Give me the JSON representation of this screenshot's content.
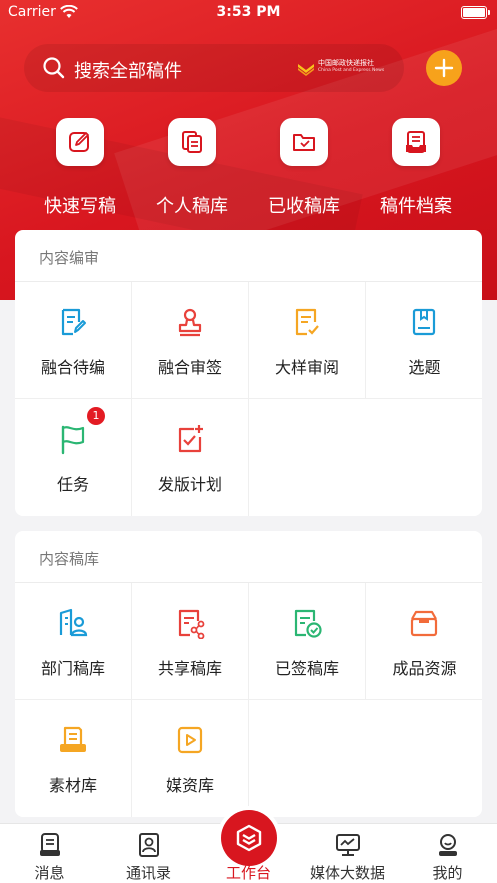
{
  "status_bar": {
    "carrier": "Carrier",
    "time": "3:53 PM"
  },
  "search": {
    "placeholder": "搜索全部稿件"
  },
  "brand": {
    "name_cn": "中国邮政快递报社",
    "name_en": "China Post and Express News"
  },
  "colors": {
    "primary": "#d8161f",
    "accent": "#f7a21b",
    "blue": "#1a9bd7",
    "green": "#2bb673",
    "orange": "#f5a623"
  },
  "quick_actions": [
    {
      "label": "快速写稿",
      "icon": "edit-icon"
    },
    {
      "label": "个人稿库",
      "icon": "documents-icon"
    },
    {
      "label": "已收稿库",
      "icon": "folder-icon"
    },
    {
      "label": "稿件档案",
      "icon": "archive-icon"
    }
  ],
  "content_review": {
    "title": "内容编审",
    "items": [
      {
        "label": "融合待编",
        "icon": "document-edit-icon"
      },
      {
        "label": "融合审签",
        "icon": "stamp-icon"
      },
      {
        "label": "大样审阅",
        "icon": "document-check-icon"
      },
      {
        "label": "选题",
        "icon": "bookmark-doc-icon"
      },
      {
        "label": "任务",
        "icon": "flag-icon",
        "badge": "1"
      },
      {
        "label": "发版计划",
        "icon": "plan-icon"
      }
    ]
  },
  "content_library": {
    "title": "内容稿库",
    "items": [
      {
        "label": "部门稿库",
        "icon": "department-icon"
      },
      {
        "label": "共享稿库",
        "icon": "share-doc-icon"
      },
      {
        "label": "已签稿库",
        "icon": "signed-doc-icon"
      },
      {
        "label": "成品资源",
        "icon": "inbox-box-icon"
      },
      {
        "label": "素材库",
        "icon": "material-icon"
      },
      {
        "label": "媒资库",
        "icon": "media-play-icon"
      }
    ]
  },
  "tab_bar": [
    {
      "label": "消息",
      "icon": "message-icon"
    },
    {
      "label": "通讯录",
      "icon": "contacts-icon"
    },
    {
      "label": "工作台",
      "icon": "workbench-icon",
      "active": true
    },
    {
      "label": "媒体大数据",
      "icon": "data-monitor-icon"
    },
    {
      "label": "我的",
      "icon": "profile-icon"
    }
  ]
}
